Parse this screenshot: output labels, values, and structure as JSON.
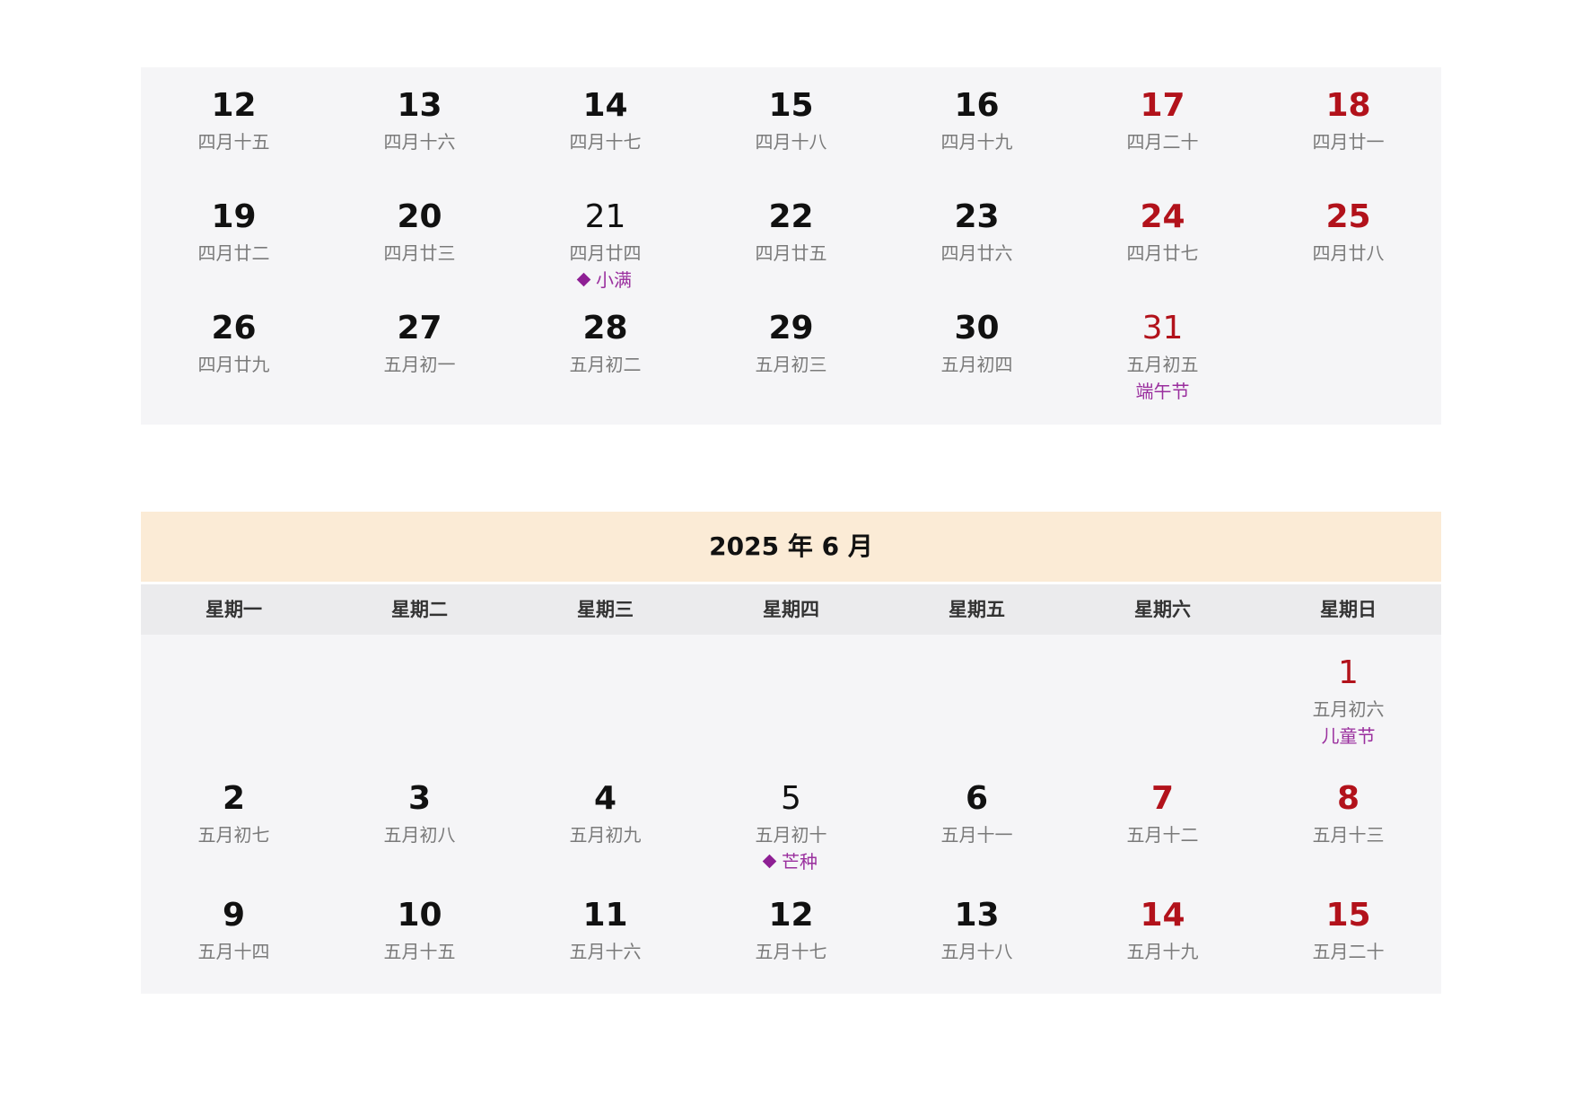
{
  "may_tail": {
    "weeks": [
      {
        "days": [
          {
            "day": "12",
            "lunar": "四月十五",
            "weekend": false,
            "bold": true
          },
          {
            "day": "13",
            "lunar": "四月十六",
            "weekend": false,
            "bold": true
          },
          {
            "day": "14",
            "lunar": "四月十七",
            "weekend": false,
            "bold": true
          },
          {
            "day": "15",
            "lunar": "四月十八",
            "weekend": false,
            "bold": true
          },
          {
            "day": "16",
            "lunar": "四月十九",
            "weekend": false,
            "bold": true
          },
          {
            "day": "17",
            "lunar": "四月二十",
            "weekend": true,
            "bold": true
          },
          {
            "day": "18",
            "lunar": "四月廿一",
            "weekend": true,
            "bold": true
          }
        ]
      },
      {
        "days": [
          {
            "day": "19",
            "lunar": "四月廿二",
            "weekend": false,
            "bold": true
          },
          {
            "day": "20",
            "lunar": "四月廿三",
            "weekend": false,
            "bold": true
          },
          {
            "day": "21",
            "lunar": "四月廿四",
            "weekend": false,
            "bold": false,
            "term": "小满"
          },
          {
            "day": "22",
            "lunar": "四月廿五",
            "weekend": false,
            "bold": true
          },
          {
            "day": "23",
            "lunar": "四月廿六",
            "weekend": false,
            "bold": true
          },
          {
            "day": "24",
            "lunar": "四月廿七",
            "weekend": true,
            "bold": true
          },
          {
            "day": "25",
            "lunar": "四月廿八",
            "weekend": true,
            "bold": true
          }
        ]
      },
      {
        "days": [
          {
            "day": "26",
            "lunar": "四月廿九",
            "weekend": false,
            "bold": true
          },
          {
            "day": "27",
            "lunar": "五月初一",
            "weekend": false,
            "bold": true
          },
          {
            "day": "28",
            "lunar": "五月初二",
            "weekend": false,
            "bold": true
          },
          {
            "day": "29",
            "lunar": "五月初三",
            "weekend": false,
            "bold": true
          },
          {
            "day": "30",
            "lunar": "五月初四",
            "weekend": false,
            "bold": true
          },
          {
            "day": "31",
            "lunar": "五月初五",
            "weekend": true,
            "bold": false,
            "festival": "端午节"
          },
          null
        ]
      }
    ]
  },
  "june": {
    "title": "2025 年 6 月",
    "weekdays": [
      "星期一",
      "星期二",
      "星期三",
      "星期四",
      "星期五",
      "星期六",
      "星期日"
    ],
    "weeks": [
      {
        "days": [
          null,
          null,
          null,
          null,
          null,
          null,
          {
            "day": "1",
            "lunar": "五月初六",
            "weekend": true,
            "bold": false,
            "festival": "儿童节"
          }
        ]
      },
      {
        "days": [
          {
            "day": "2",
            "lunar": "五月初七",
            "weekend": false,
            "bold": true
          },
          {
            "day": "3",
            "lunar": "五月初八",
            "weekend": false,
            "bold": true
          },
          {
            "day": "4",
            "lunar": "五月初九",
            "weekend": false,
            "bold": true
          },
          {
            "day": "5",
            "lunar": "五月初十",
            "weekend": false,
            "bold": false,
            "term": "芒种"
          },
          {
            "day": "6",
            "lunar": "五月十一",
            "weekend": false,
            "bold": true
          },
          {
            "day": "7",
            "lunar": "五月十二",
            "weekend": true,
            "bold": true
          },
          {
            "day": "8",
            "lunar": "五月十三",
            "weekend": true,
            "bold": true
          }
        ]
      },
      {
        "days": [
          {
            "day": "9",
            "lunar": "五月十四",
            "weekend": false,
            "bold": true
          },
          {
            "day": "10",
            "lunar": "五月十五",
            "weekend": false,
            "bold": true
          },
          {
            "day": "11",
            "lunar": "五月十六",
            "weekend": false,
            "bold": true
          },
          {
            "day": "12",
            "lunar": "五月十七",
            "weekend": false,
            "bold": true
          },
          {
            "day": "13",
            "lunar": "五月十八",
            "weekend": false,
            "bold": true
          },
          {
            "day": "14",
            "lunar": "五月十九",
            "weekend": true,
            "bold": true
          },
          {
            "day": "15",
            "lunar": "五月二十",
            "weekend": true,
            "bold": true
          }
        ]
      }
    ]
  },
  "colors": {
    "weekend": "#b2121b",
    "festival": "#9a2f9e",
    "month_header_bg": "#fbebd6",
    "weekday_header_bg": "#ebebed",
    "grid_bg": "#f5f5f7"
  }
}
